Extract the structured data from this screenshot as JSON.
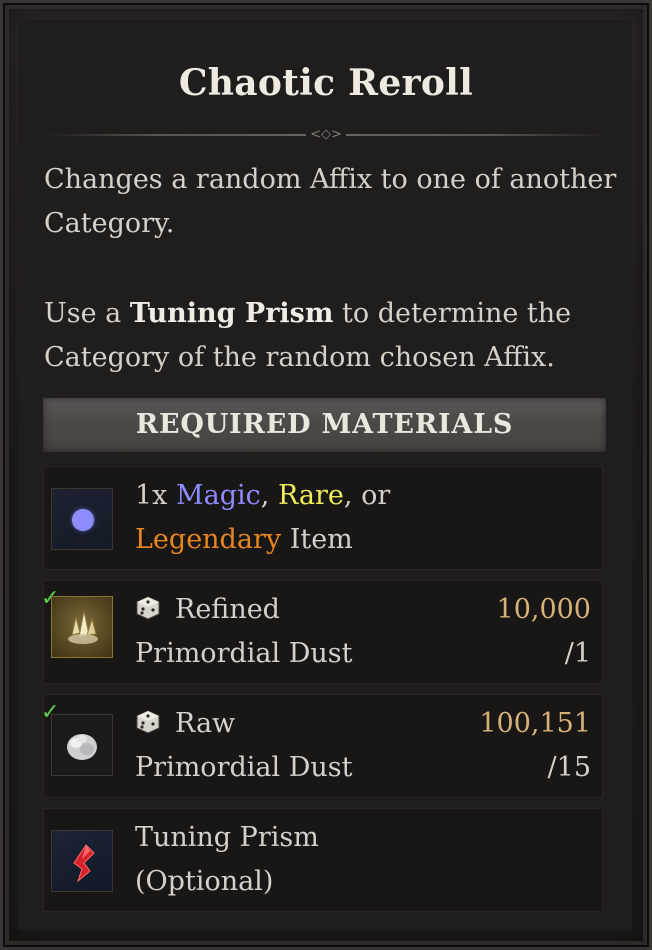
{
  "title": "Chaotic Reroll",
  "description": {
    "line1": "Changes a random Affix to one of another Category.",
    "line2_prefix": "Use a ",
    "line2_emphasis": "Tuning Prism",
    "line2_suffix": " to determine the Category of the random chosen Affix."
  },
  "required_materials": {
    "header": "REQUIRED MATERIALS",
    "items": [
      {
        "icon": "magic-item-icon",
        "prefix": "1x ",
        "magic": "Magic",
        "sep1": ", ",
        "rare": "Rare",
        "sep2": ", or",
        "legendary": "Legendary",
        "suffix": " Item"
      },
      {
        "icon": "refined-primordial-dust-icon",
        "checked": true,
        "name_line1": "Refined",
        "name_line2": "Primordial Dust",
        "have": "10,000",
        "need": "/1"
      },
      {
        "icon": "raw-primordial-dust-icon",
        "checked": true,
        "name_line1": "Raw",
        "name_line2": "Primordial Dust",
        "have": "100,151",
        "need": "/15"
      },
      {
        "icon": "tuning-prism-icon",
        "name_line1": "Tuning Prism",
        "name_line2": "(Optional)"
      }
    ]
  },
  "colors": {
    "magic": "#8d8cff",
    "rare": "#f0ec5a",
    "legendary": "#e7851f",
    "quantity": "#d7b177",
    "check": "#5ccf4a"
  }
}
